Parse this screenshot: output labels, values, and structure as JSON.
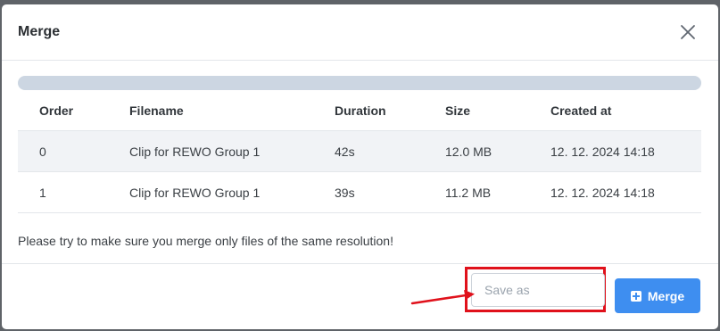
{
  "dialog": {
    "title": "Merge",
    "close_icon": "close-icon"
  },
  "progress": {
    "percent": 0,
    "track_color": "#ccd6e2",
    "fill_color": "#3e8ef0"
  },
  "table": {
    "columns": [
      "Order",
      "Filename",
      "Duration",
      "Size",
      "Created at"
    ],
    "rows": [
      {
        "order": "0",
        "filename": "Clip for REWO Group 1",
        "duration": "42s",
        "size": "12.0 MB",
        "created_at": "12. 12. 2024 14:18"
      },
      {
        "order": "1",
        "filename": "Clip for REWO Group 1",
        "duration": "39s",
        "size": "11.2 MB",
        "created_at": "12. 12. 2024 14:18"
      }
    ]
  },
  "note": "Please try to make sure you merge only files of the same resolution!",
  "footer": {
    "save_as_placeholder": "Save as",
    "save_as_value": "",
    "merge_label": "Merge",
    "merge_icon": "plus-square-icon"
  },
  "annotation": {
    "color": "#e0111b"
  },
  "colors": {
    "primary": "#3e8ef0",
    "stripe": "#f1f3f6",
    "border": "#e3e6ea"
  }
}
